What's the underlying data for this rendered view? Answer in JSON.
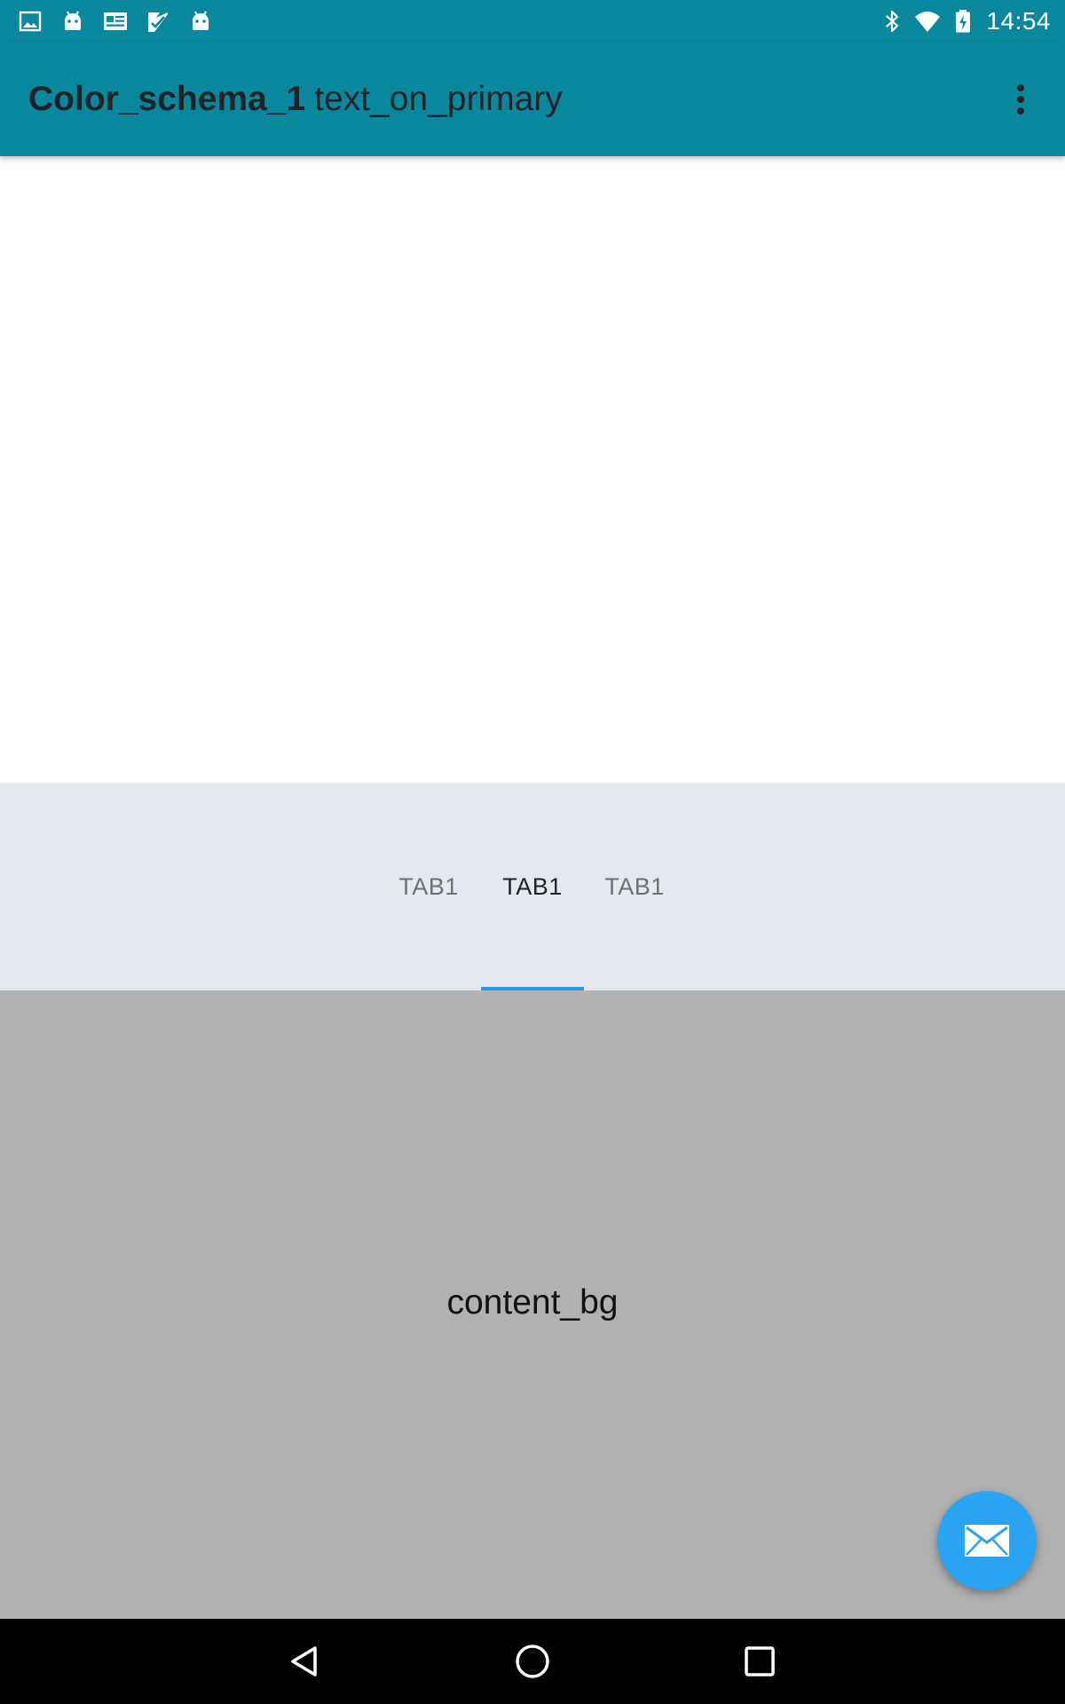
{
  "status_bar": {
    "time": "14:54",
    "left_icons": [
      "image-icon",
      "android-icon",
      "news-icon",
      "play-store-icon",
      "android-icon"
    ],
    "right_icons": [
      "bluetooth-icon",
      "wifi-icon",
      "battery-charging-icon"
    ]
  },
  "app_bar": {
    "title_primary": "Color_schema_1",
    "title_secondary": "text_on_primary",
    "overflow_icon": "more-vert-icon"
  },
  "tabs": [
    {
      "label": "TAB1",
      "selected": false
    },
    {
      "label": "TAB1",
      "selected": true
    },
    {
      "label": "TAB1",
      "selected": false
    }
  ],
  "content": {
    "label": "content_bg"
  },
  "fab": {
    "icon": "mail-icon"
  },
  "nav_bar": {
    "buttons": [
      "back-icon",
      "home-icon",
      "recents-icon"
    ]
  },
  "colors": {
    "primary": "#09889d",
    "tab_strip_bg": "#e5e8ef",
    "tab_indicator": "#2196f3",
    "content_bg": "#b1b1b1",
    "fab": "#2aa3f3",
    "text_on_primary": "#1f2327"
  }
}
